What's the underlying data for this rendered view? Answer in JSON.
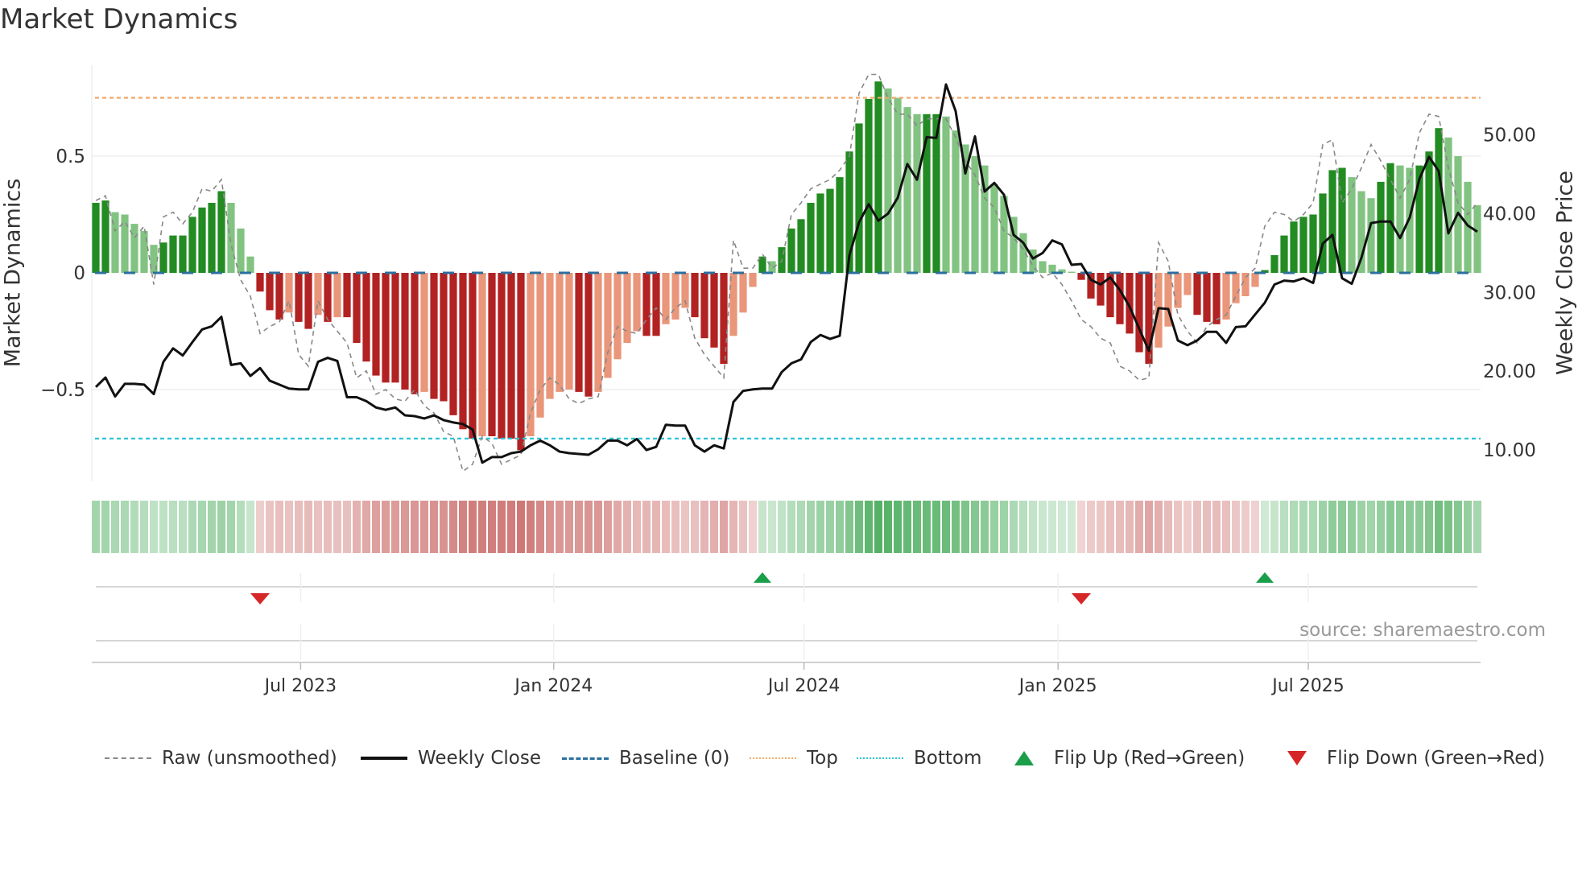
{
  "title": "Market Dynamics",
  "source": "source: sharemaestro.com",
  "legend": {
    "raw": "Raw (unsmoothed)",
    "close": "Weekly Close",
    "baseline": "Baseline (0)",
    "top": "Top",
    "bottom": "Bottom",
    "flip_up": "Flip Up (Red→Green)",
    "flip_down": "Flip Down (Green→Red)"
  },
  "colors": {
    "pos_strong": "#228b22",
    "pos_weak": "#82c382",
    "neg_strong": "#b22222",
    "neg_weak": "#e9967a",
    "heat_pos": "#2ea043",
    "heat_neg": "#c0504d",
    "raw": "#888888",
    "close": "#111111",
    "baseline": "#2b6f9e",
    "top": "#f0a868",
    "bottom": "#2ec4d6",
    "flip_up": "#1a9e4a",
    "flip_down": "#d62728"
  },
  "chart_data": {
    "type": "bar",
    "title": "Market Dynamics",
    "ylabel": "Market Dynamics",
    "y2label": "Weekly Close Price",
    "ylim": [
      -0.92,
      0.89
    ],
    "y2lim": [
      5.0,
      63.0
    ],
    "yticks": [
      {
        "v": 0.5,
        "label": "0.5"
      },
      {
        "v": 0,
        "label": "0"
      },
      {
        "v": -0.5,
        "label": "−0.5"
      }
    ],
    "y2ticks": [
      {
        "v": 50,
        "label": "50.00"
      },
      {
        "v": 40,
        "label": "40.00"
      },
      {
        "v": 30,
        "label": "30.00"
      },
      {
        "v": 20,
        "label": "20.00"
      },
      {
        "v": 10,
        "label": "10.00"
      }
    ],
    "xticks": [
      {
        "week": 22.2,
        "label": "Jul 2023"
      },
      {
        "week": 48.4,
        "label": "Jan 2024"
      },
      {
        "week": 74.3,
        "label": "Jul 2024"
      },
      {
        "week": 100.6,
        "label": "Jan 2025"
      },
      {
        "week": 126.5,
        "label": "Jul 2025"
      }
    ],
    "top_level": 0.75,
    "bottom_level": -0.71,
    "baseline": 0,
    "values": [
      0.3,
      0.31,
      0.26,
      0.25,
      0.21,
      0.18,
      0.12,
      0.13,
      0.16,
      0.16,
      0.24,
      0.28,
      0.3,
      0.35,
      0.3,
      0.19,
      0.07,
      -0.08,
      -0.16,
      -0.2,
      -0.17,
      -0.21,
      -0.24,
      -0.18,
      -0.21,
      -0.19,
      -0.19,
      -0.3,
      -0.38,
      -0.44,
      -0.47,
      -0.47,
      -0.5,
      -0.52,
      -0.51,
      -0.54,
      -0.55,
      -0.61,
      -0.67,
      -0.71,
      -0.7,
      -0.7,
      -0.71,
      -0.71,
      -0.76,
      -0.7,
      -0.62,
      -0.54,
      -0.51,
      -0.5,
      -0.51,
      -0.53,
      -0.51,
      -0.45,
      -0.37,
      -0.3,
      -0.25,
      -0.27,
      -0.27,
      -0.22,
      -0.2,
      -0.15,
      -0.19,
      -0.28,
      -0.32,
      -0.39,
      -0.27,
      -0.17,
      -0.06,
      0.07,
      0.05,
      0.11,
      0.19,
      0.23,
      0.3,
      0.34,
      0.36,
      0.41,
      0.52,
      0.64,
      0.745,
      0.82,
      0.79,
      0.75,
      0.71,
      0.68,
      0.68,
      0.68,
      0.67,
      0.61,
      0.55,
      0.5,
      0.46,
      0.38,
      0.33,
      0.24,
      0.17,
      0.1,
      0.05,
      0.035,
      0.015,
      0.005,
      -0.03,
      -0.11,
      -0.14,
      -0.19,
      -0.22,
      -0.26,
      -0.34,
      -0.39,
      -0.32,
      -0.23,
      -0.15,
      -0.095,
      -0.18,
      -0.21,
      -0.22,
      -0.2,
      -0.13,
      -0.1,
      -0.06,
      0.012,
      0.076,
      0.16,
      0.22,
      0.24,
      0.25,
      0.34,
      0.44,
      0.45,
      0.41,
      0.35,
      0.32,
      0.39,
      0.47,
      0.46,
      0.45,
      0.46,
      0.52,
      0.62,
      0.58,
      0.5,
      0.39,
      0.29
    ],
    "raw": [
      0.31,
      0.33,
      0.18,
      0.22,
      0.15,
      0.2,
      -0.05,
      0.24,
      0.26,
      0.21,
      0.26,
      0.36,
      0.35,
      0.4,
      0.12,
      -0.03,
      -0.1,
      -0.26,
      -0.23,
      -0.21,
      -0.12,
      -0.35,
      -0.4,
      -0.12,
      -0.2,
      -0.25,
      -0.3,
      -0.45,
      -0.42,
      -0.52,
      -0.5,
      -0.54,
      -0.55,
      -0.5,
      -0.57,
      -0.6,
      -0.68,
      -0.7,
      -0.85,
      -0.82,
      -0.7,
      -0.73,
      -0.82,
      -0.8,
      -0.78,
      -0.6,
      -0.5,
      -0.45,
      -0.48,
      -0.54,
      -0.56,
      -0.54,
      -0.53,
      -0.34,
      -0.23,
      -0.25,
      -0.26,
      -0.2,
      -0.15,
      -0.2,
      -0.15,
      -0.12,
      -0.28,
      -0.35,
      -0.4,
      -0.45,
      0.14,
      0.02,
      0.02,
      0.08,
      0.02,
      0.05,
      0.25,
      0.3,
      0.36,
      0.38,
      0.4,
      0.44,
      0.5,
      0.77,
      0.85,
      0.85,
      0.75,
      0.68,
      0.68,
      0.63,
      0.66,
      0.66,
      0.66,
      0.58,
      0.48,
      0.42,
      0.32,
      0.28,
      0.18,
      0.15,
      0.1,
      0.03,
      -0.02,
      0.0,
      -0.05,
      -0.12,
      -0.2,
      -0.23,
      -0.28,
      -0.3,
      -0.4,
      -0.42,
      -0.46,
      -0.45,
      0.13,
      0.05,
      -0.18,
      -0.25,
      -0.3,
      -0.23,
      -0.2,
      -0.18,
      -0.1,
      -0.02,
      0.02,
      0.2,
      0.26,
      0.25,
      0.22,
      0.25,
      0.3,
      0.55,
      0.57,
      0.3,
      0.36,
      0.45,
      0.55,
      0.48,
      0.4,
      0.32,
      0.4,
      0.6,
      0.68,
      0.67,
      0.45,
      0.3,
      0.25,
      0.3
    ],
    "close": [
      18.0,
      19.2,
      16.8,
      18.4,
      18.4,
      18.3,
      17.1,
      21.2,
      22.9,
      22.0,
      23.7,
      25.3,
      25.7,
      26.9,
      20.8,
      21.0,
      19.4,
      20.4,
      18.8,
      18.3,
      17.8,
      17.7,
      17.7,
      21.2,
      21.7,
      21.3,
      16.7,
      16.7,
      16.2,
      15.4,
      15.1,
      15.4,
      14.4,
      14.3,
      14.0,
      14.4,
      13.8,
      13.5,
      13.3,
      12.6,
      8.4,
      9.1,
      9.1,
      9.6,
      9.8,
      10.6,
      11.2,
      10.6,
      9.8,
      9.6,
      9.5,
      9.4,
      10.1,
      11.2,
      11.2,
      10.6,
      11.4,
      10.0,
      10.4,
      13.2,
      13.1,
      13.1,
      10.6,
      9.8,
      10.6,
      10.2,
      16.1,
      17.5,
      17.7,
      17.8,
      17.8,
      19.9,
      21.0,
      21.5,
      23.7,
      24.6,
      24.1,
      24.5,
      34.7,
      38.9,
      41.2,
      39.1,
      40.0,
      42.0,
      46.3,
      44.3,
      49.7,
      49.6,
      56.4,
      53.0,
      45.1,
      49.8,
      42.8,
      43.9,
      42.4,
      37.3,
      36.3,
      34.3,
      35.0,
      36.6,
      36.1,
      33.5,
      33.6,
      31.6,
      31.0,
      31.9,
      30.3,
      28.2,
      25.4,
      22.6,
      28.0,
      27.9,
      23.9,
      23.3,
      23.9,
      25.0,
      25.0,
      23.6,
      25.6,
      25.7,
      27.2,
      28.7,
      31.0,
      31.5,
      31.4,
      31.8,
      31.2,
      36.2,
      37.3,
      31.8,
      31.1,
      34.4,
      38.8,
      39.0,
      39.0,
      36.9,
      39.5,
      44.4,
      47.2,
      45.4,
      37.5,
      40.1,
      38.5,
      37.7
    ],
    "flips": [
      {
        "week": 18,
        "dir": "down"
      },
      {
        "week": 70,
        "dir": "up"
      },
      {
        "week": 103,
        "dir": "down"
      },
      {
        "week": 122,
        "dir": "up"
      }
    ]
  }
}
